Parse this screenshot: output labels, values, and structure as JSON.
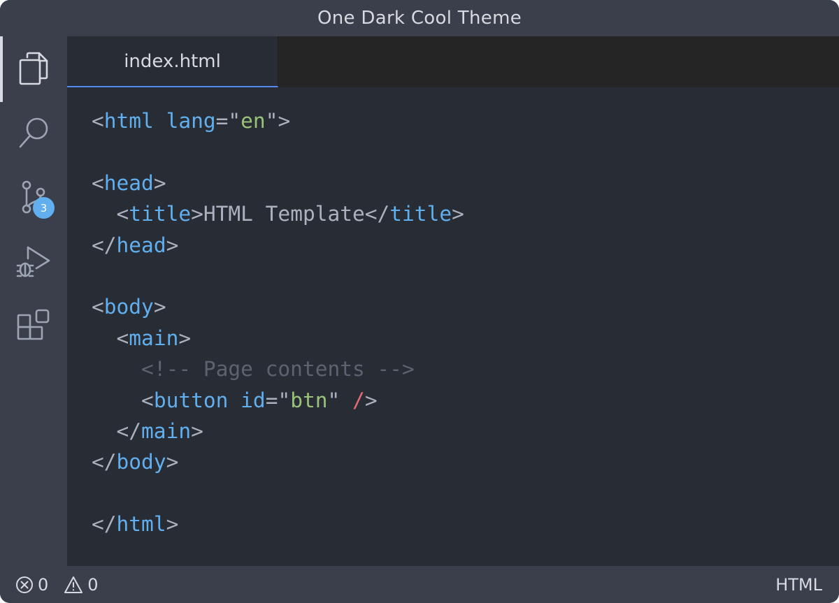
{
  "window": {
    "title": "One Dark Cool Theme"
  },
  "activity_bar": {
    "items": [
      {
        "icon": "files-icon",
        "active": true
      },
      {
        "icon": "search-icon",
        "active": false
      },
      {
        "icon": "source-control-icon",
        "active": false,
        "badge": "3"
      },
      {
        "icon": "run-debug-icon",
        "active": false
      },
      {
        "icon": "extensions-icon",
        "active": false
      }
    ]
  },
  "tabs": [
    {
      "label": "index.html",
      "active": true
    }
  ],
  "editor": {
    "lines": [
      [
        [
          "p",
          "<"
        ],
        [
          "t",
          "html"
        ],
        [
          "p",
          " "
        ],
        [
          "a",
          "lang"
        ],
        [
          "p",
          "=\""
        ],
        [
          "s",
          "en"
        ],
        [
          "p",
          "\">"
        ]
      ],
      [],
      [
        [
          "p",
          "<"
        ],
        [
          "t",
          "head"
        ],
        [
          "p",
          ">"
        ]
      ],
      [
        [
          "p",
          "  <"
        ],
        [
          "t",
          "title"
        ],
        [
          "p",
          ">HTML Template</"
        ],
        [
          "t",
          "title"
        ],
        [
          "p",
          ">"
        ]
      ],
      [
        [
          "p",
          "</"
        ],
        [
          "t",
          "head"
        ],
        [
          "p",
          ">"
        ]
      ],
      [],
      [
        [
          "p",
          "<"
        ],
        [
          "t",
          "body"
        ],
        [
          "p",
          ">"
        ]
      ],
      [
        [
          "p",
          "  <"
        ],
        [
          "t",
          "main"
        ],
        [
          "p",
          ">"
        ]
      ],
      [
        [
          "c",
          "    <!-- Page contents -->"
        ]
      ],
      [
        [
          "p",
          "    <"
        ],
        [
          "t",
          "button"
        ],
        [
          "p",
          " "
        ],
        [
          "a",
          "id"
        ],
        [
          "p",
          "=\""
        ],
        [
          "s",
          "btn"
        ],
        [
          "p",
          "\" "
        ],
        [
          "r",
          "/"
        ],
        [
          "p",
          ">"
        ]
      ],
      [
        [
          "p",
          "  </"
        ],
        [
          "t",
          "main"
        ],
        [
          "p",
          ">"
        ]
      ],
      [
        [
          "p",
          "</"
        ],
        [
          "t",
          "body"
        ],
        [
          "p",
          ">"
        ]
      ],
      [],
      [
        [
          "p",
          "</"
        ],
        [
          "t",
          "html"
        ],
        [
          "p",
          ">"
        ]
      ]
    ]
  },
  "status_bar": {
    "errors": "0",
    "warnings": "0",
    "language": "HTML"
  },
  "colors": {
    "background": "#3a3f4b",
    "editor": "#282c34",
    "tag": "#61afef",
    "string": "#98c379",
    "comment": "#5c6370",
    "punctuation": "#abb2bf",
    "accent": "#568af2"
  }
}
